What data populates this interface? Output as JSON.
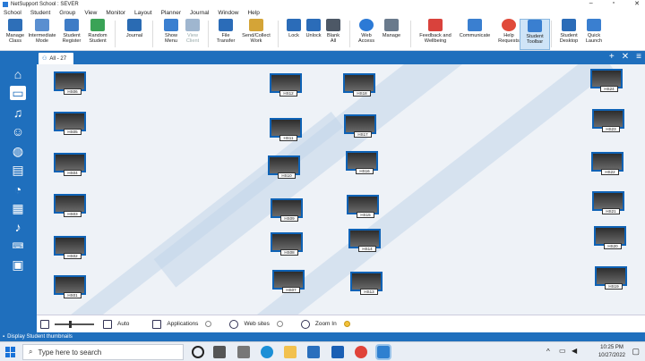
{
  "window": {
    "title": "NetSupport School : SEVER"
  },
  "menu": [
    "School",
    "Student",
    "Group",
    "View",
    "Monitor",
    "Layout",
    "Planner",
    "Journal",
    "Window",
    "Help"
  ],
  "ribbon": [
    {
      "l1": "Manage",
      "l2": "Class",
      "color": "#2e6fb8"
    },
    {
      "l1": "Intermediate",
      "l2": "Mode",
      "color": "#5a8fd0"
    },
    {
      "l1": "Student",
      "l2": "Register",
      "color": "#3e7cc6"
    },
    {
      "l1": "Random",
      "l2": "Student",
      "color": "#3aa356"
    },
    {
      "l1": "Journal",
      "l2": "",
      "color": "#2a6bb3"
    },
    {
      "l1": "Show",
      "l2": "Menu",
      "color": "#3a7fd0"
    },
    {
      "l1": "View",
      "l2": "Client",
      "color": "#9fb6cf"
    },
    {
      "l1": "File",
      "l2": "Transfer",
      "color": "#2b6cb8"
    },
    {
      "l1": "Send/Collect",
      "l2": "Work",
      "color": "#d4a437"
    },
    {
      "l1": "Lock",
      "l2": "",
      "color": "#2b6cb8"
    },
    {
      "l1": "Unlock",
      "l2": "",
      "color": "#2b6cb8"
    },
    {
      "l1": "Blank",
      "l2": "All",
      "color": "#4d5866"
    },
    {
      "l1": "Web",
      "l2": "Access",
      "color": "#2c7ad6"
    },
    {
      "l1": "Manage",
      "l2": "",
      "color": "#6a7a8c"
    },
    {
      "l1": "Feedback and",
      "l2": "Wellbeing",
      "color": "#d9423c"
    },
    {
      "l1": "Communicate",
      "l2": "",
      "color": "#3a7fd0"
    },
    {
      "l1": "Help",
      "l2": "Requests",
      "color": "#e04a3a"
    },
    {
      "l1": "Student",
      "l2": "Toolbar",
      "color": "#3a7fd0"
    },
    {
      "l1": "Student",
      "l2": "Desktop",
      "color": "#2b6cb8"
    },
    {
      "l1": "Quick",
      "l2": "Launch",
      "color": "#3a7fd0"
    }
  ],
  "tab": {
    "label": "All - 27"
  },
  "tab_tools": [
    "+",
    "✕",
    "≡"
  ],
  "students": [
    {
      "name": "HS06"
    },
    {
      "name": "HS05"
    },
    {
      "name": "HS04"
    },
    {
      "name": "HS03"
    },
    {
      "name": "HS02"
    },
    {
      "name": "HS01"
    },
    {
      "name": "HS12"
    },
    {
      "name": "HS11"
    },
    {
      "name": "HS10"
    },
    {
      "name": "HS09"
    },
    {
      "name": "HS08"
    },
    {
      "name": "HS07"
    },
    {
      "name": "HS18"
    },
    {
      "name": "HS17"
    },
    {
      "name": "HS16"
    },
    {
      "name": "HS15"
    },
    {
      "name": "HS14"
    },
    {
      "name": "HS13"
    },
    {
      "name": "HS24"
    },
    {
      "name": "HS23"
    },
    {
      "name": "HS22"
    },
    {
      "name": "HS21"
    },
    {
      "name": "HS20"
    },
    {
      "name": "HS19"
    }
  ],
  "bottom": {
    "auto": "Auto",
    "applications": "Applications",
    "websites": "Web sites",
    "zoom": "Zoom In"
  },
  "status": {
    "text": "Display Student thumbnails"
  },
  "taskbar": {
    "search_placeholder": "Type here to search",
    "time": "10:25 PM",
    "date": "10/27/2022"
  },
  "colors": {
    "accent": "#1f6fbd",
    "monitor_border": "#0e62b5"
  }
}
